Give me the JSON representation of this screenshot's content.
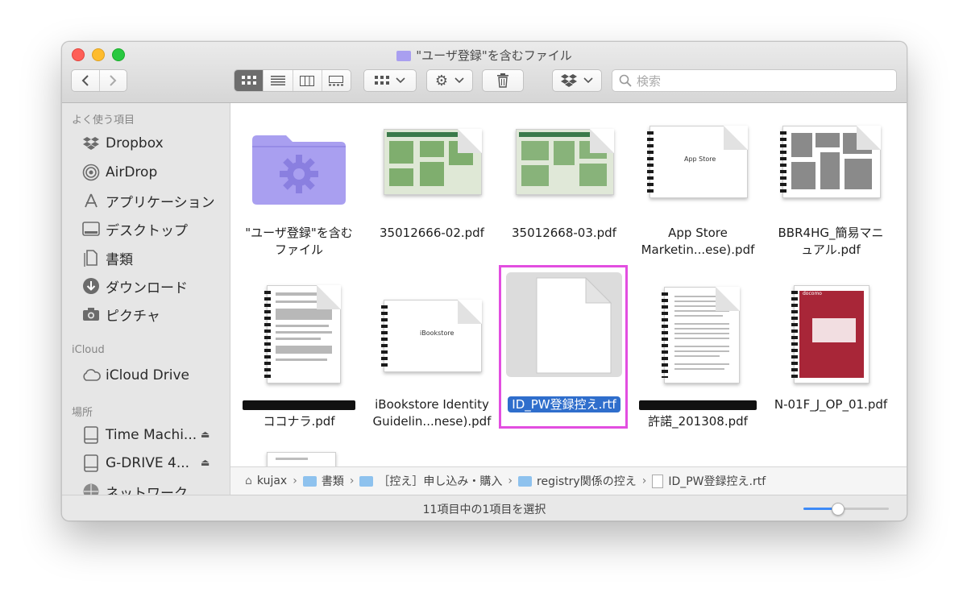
{
  "window": {
    "title": "\"ユーザ登録\"を含むファイル"
  },
  "toolbar": {
    "back_icon": "chevron-left-icon",
    "forward_icon": "chevron-right-icon",
    "views": [
      "icon-view",
      "list-view",
      "column-view",
      "gallery-view"
    ],
    "active_view": "icon-view",
    "search_placeholder": "検索"
  },
  "sidebar": {
    "favorites_heading": "よく使う項目",
    "favorites": [
      {
        "label": "Dropbox",
        "icon": "dropbox-icon"
      },
      {
        "label": "AirDrop",
        "icon": "airdrop-icon"
      },
      {
        "label": "アプリケーション",
        "icon": "applications-icon"
      },
      {
        "label": "デスクトップ",
        "icon": "desktop-icon"
      },
      {
        "label": "書類",
        "icon": "documents-icon"
      },
      {
        "label": "ダウンロード",
        "icon": "downloads-icon"
      },
      {
        "label": "ピクチャ",
        "icon": "pictures-icon"
      }
    ],
    "icloud_heading": "iCloud",
    "icloud": [
      {
        "label": "iCloud Drive",
        "icon": "cloud-icon"
      }
    ],
    "locations_heading": "場所",
    "locations": [
      {
        "label": "Time Machi...",
        "icon": "disk-icon"
      },
      {
        "label": "G-DRIVE 4...",
        "icon": "disk-icon"
      },
      {
        "label": "ネットワーク",
        "icon": "network-icon"
      }
    ]
  },
  "files": [
    {
      "line1": "\"ユーザ登録\"を含む",
      "line2": "ファイル"
    },
    {
      "line1": "35012666-02.pdf",
      "line2": ""
    },
    {
      "line1": "35012668-03.pdf",
      "line2": ""
    },
    {
      "line1": "App Store",
      "line2": "Marketin...ese).pdf"
    },
    {
      "line1": "BBR4HG_簡易マニ",
      "line2": "ュアル.pdf"
    },
    {
      "line1": "",
      "line2": "ココナラ.pdf"
    },
    {
      "line1": "iBookstore Identity",
      "line2": "Guidelin...nese).pdf"
    },
    {
      "line1": "ID_PW登録控え.rtf",
      "line2": ""
    },
    {
      "line1": "",
      "line2": "許諾_201308.pdf"
    },
    {
      "line1": "N-01F_J_OP_01.pdf",
      "line2": ""
    }
  ],
  "thumb_text": {
    "appstore": "App Store",
    "ibookstore": "iBookstore",
    "docomo": "docomo"
  },
  "pathbar": [
    "kujax",
    "書類",
    "［控え］申し込み・購入",
    "registry関係の控え",
    "ID_PW登録控え.rtf"
  ],
  "status": {
    "text": "11項目中の1項目を選択",
    "icon_size": 0.4
  },
  "colors": {
    "folder": "#a99ff0",
    "selection": "#2f6ecc",
    "highlight_border": "#e24ee0"
  }
}
